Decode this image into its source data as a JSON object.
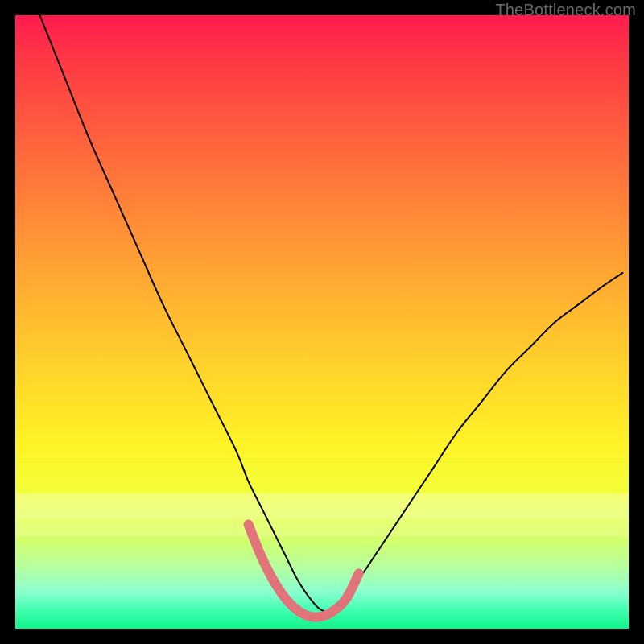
{
  "watermark": "TheBottleneck.com",
  "chart_data": {
    "type": "line",
    "title": "",
    "xlabel": "",
    "ylabel": "",
    "xlim": [
      0,
      100
    ],
    "ylim": [
      0,
      100
    ],
    "grid": false,
    "legend": false,
    "series": [
      {
        "name": "thin-black-curve",
        "color": "#000000",
        "stroke_width": 2,
        "x": [
          4,
          8,
          12,
          16,
          20,
          24,
          28,
          32,
          36,
          38,
          40,
          42,
          44,
          46,
          48,
          50,
          52,
          54,
          56,
          60,
          64,
          68,
          72,
          76,
          80,
          84,
          88,
          92,
          96,
          99
        ],
        "values": [
          100,
          90,
          80,
          71,
          62,
          53,
          45,
          37,
          29,
          24,
          20,
          16,
          12,
          8,
          5,
          3,
          3,
          5,
          8,
          14,
          20,
          26,
          32,
          37,
          42,
          46,
          50,
          53,
          56,
          58
        ]
      },
      {
        "name": "pink-bottom-segment",
        "color": "#e0747a",
        "stroke_width": 12,
        "x": [
          38,
          40,
          42,
          44,
          46,
          48,
          50,
          52,
          54,
          56
        ],
        "values": [
          17,
          12,
          8,
          5,
          3,
          2,
          2,
          3,
          5,
          9
        ]
      }
    ],
    "background_gradient": {
      "top_color": "#ff1a4f",
      "mid_color": "#ffe328",
      "bottom_color": "#10f48c"
    }
  }
}
